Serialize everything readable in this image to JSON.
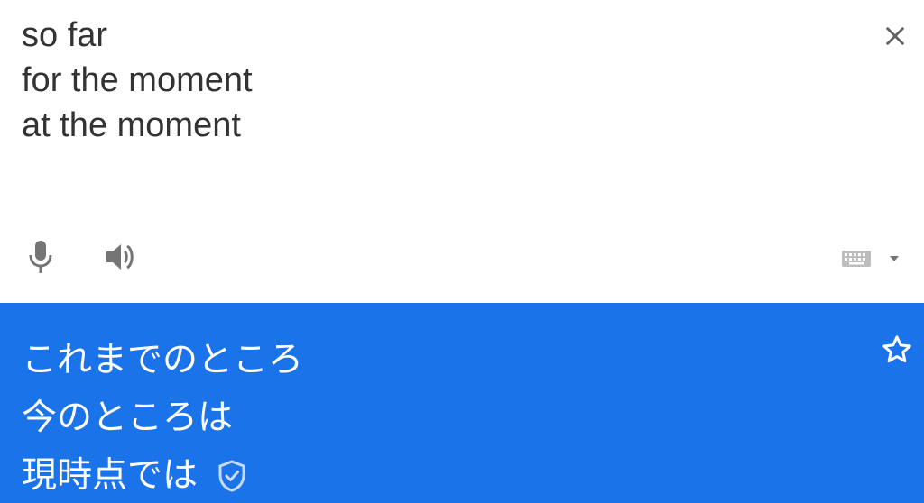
{
  "source": {
    "lines": [
      "so far",
      "for the moment",
      "at the moment"
    ],
    "text_color": "#333333"
  },
  "target": {
    "lines": [
      "これまでのところ",
      "今のところは",
      "現時点では"
    ],
    "background_color": "#1a73e8",
    "text_color": "#ffffff"
  },
  "icons": {
    "close": "close-icon",
    "mic": "mic-icon",
    "speaker": "speaker-icon",
    "keyboard": "keyboard-icon",
    "dropdown": "dropdown-arrow-icon",
    "star": "star-outline-icon",
    "verified": "verified-shield-icon"
  }
}
